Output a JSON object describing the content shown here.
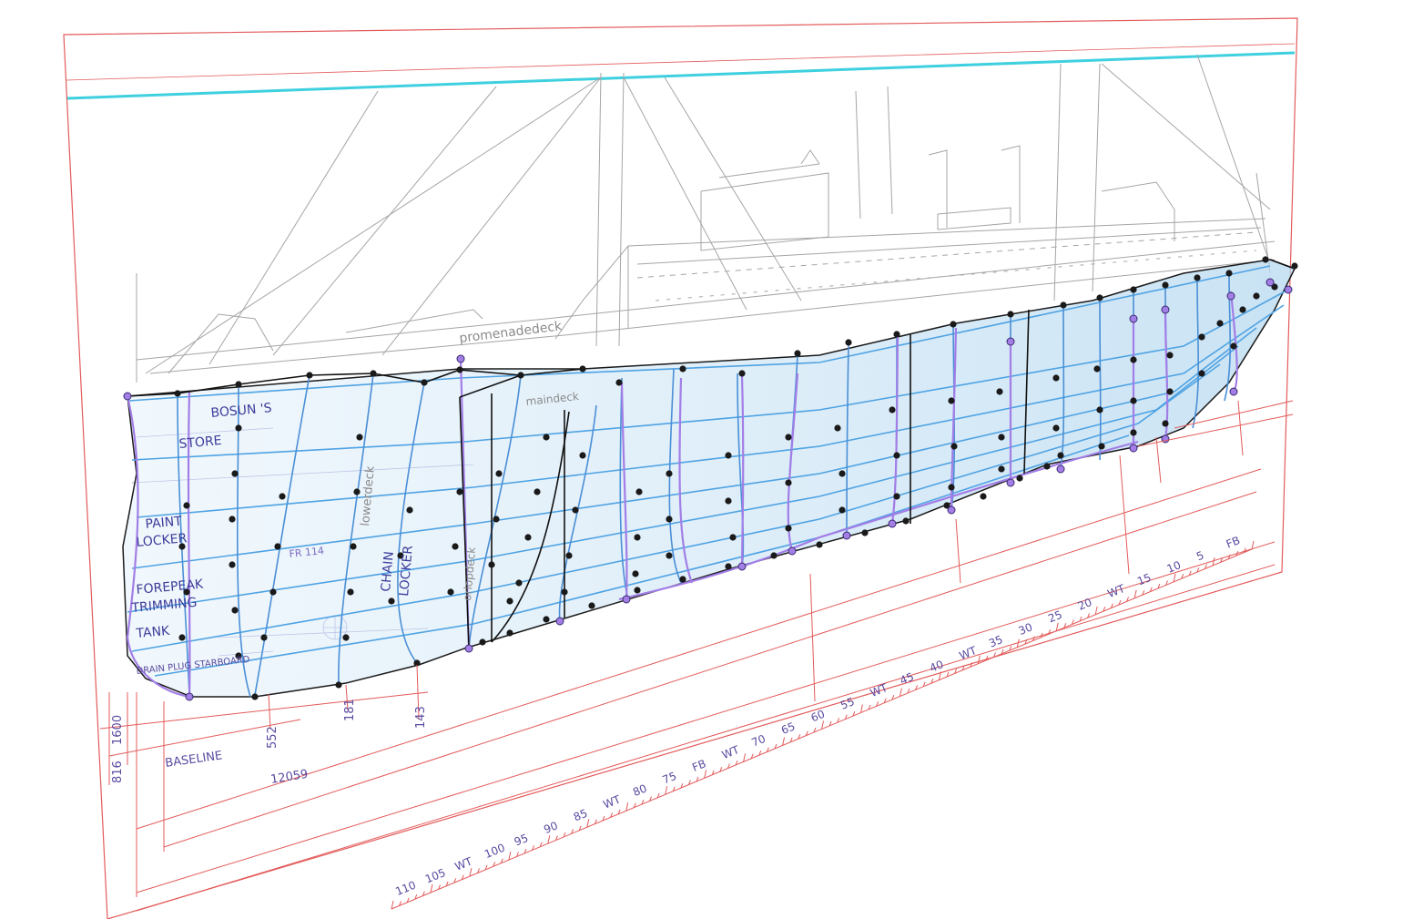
{
  "drawing": {
    "deck_labels": {
      "promenade": "promenadedeck",
      "main": "maindeck",
      "lower": "lowerdeck",
      "orlop": "orlopdeck"
    },
    "compartments": [
      "BOSUN 'S",
      "STORE",
      "PAINT",
      "LOCKER",
      "FOREPEAK",
      "TRIMMING",
      "TANK",
      "CHAIN",
      "LOCKER"
    ],
    "notes": {
      "drain_plug": "DRAIN PLUG STARBOARD",
      "frame_ref": "FR 114",
      "baseline": "BASELINE",
      "dim_12059": "12059",
      "dim_1600": "1600",
      "dim_816": "816",
      "dim_552": "552",
      "dim_181": "181",
      "dim_143": "143"
    },
    "scale_labels": [
      "110",
      "105",
      "WT",
      "100",
      "95",
      "90",
      "85",
      "WT",
      "80",
      "75",
      "FB",
      "WT",
      "70",
      "65",
      "60",
      "55",
      "WT",
      "45",
      "40",
      "WT",
      "35",
      "30",
      "25",
      "20",
      "WT",
      "15",
      "10",
      "5",
      "FB"
    ],
    "colors": {
      "frame_red": "#e05050",
      "cyan": "#3fd0e0",
      "station_blue": "#4a8fd6",
      "waterline_blue": "#5aa9e6",
      "purple": "#a27ee6",
      "hull_fill": "#cfe6f5",
      "ship_gray": "#9a9a9a"
    }
  }
}
